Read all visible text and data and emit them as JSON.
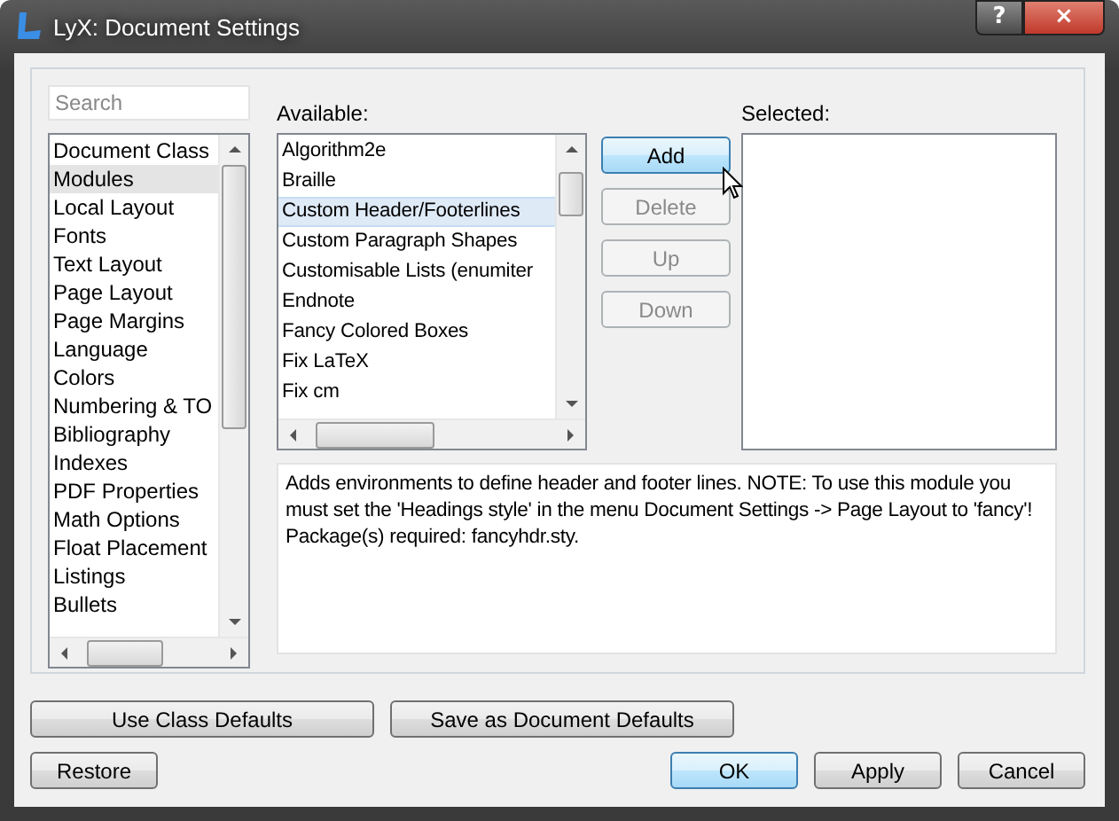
{
  "window": {
    "title": "LyX: Document Settings",
    "help_button": "?",
    "close_button": "×"
  },
  "search": {
    "placeholder": "Search"
  },
  "categories": [
    {
      "label": "Document Class",
      "selected": false
    },
    {
      "label": "Modules",
      "selected": true
    },
    {
      "label": "Local Layout",
      "selected": false
    },
    {
      "label": "Fonts",
      "selected": false
    },
    {
      "label": "Text Layout",
      "selected": false
    },
    {
      "label": "Page Layout",
      "selected": false
    },
    {
      "label": "Page Margins",
      "selected": false
    },
    {
      "label": "Language",
      "selected": false
    },
    {
      "label": "Colors",
      "selected": false
    },
    {
      "label": "Numbering & TO",
      "selected": false
    },
    {
      "label": "Bibliography",
      "selected": false
    },
    {
      "label": "Indexes",
      "selected": false
    },
    {
      "label": "PDF Properties",
      "selected": false
    },
    {
      "label": "Math Options",
      "selected": false
    },
    {
      "label": "Float Placement",
      "selected": false
    },
    {
      "label": "Listings",
      "selected": false
    },
    {
      "label": "Bullets",
      "selected": false
    }
  ],
  "available": {
    "label": "Available:",
    "items": [
      {
        "label": "Algorithm2e",
        "selected": false
      },
      {
        "label": "Braille",
        "selected": false
      },
      {
        "label": "Custom Header/Footerlines",
        "selected": true
      },
      {
        "label": "Custom Paragraph Shapes",
        "selected": false
      },
      {
        "label": "Customisable Lists (enumiter",
        "selected": false
      },
      {
        "label": "Endnote",
        "selected": false
      },
      {
        "label": "Fancy Colored Boxes",
        "selected": false
      },
      {
        "label": "Fix LaTeX",
        "selected": false
      },
      {
        "label": "Fix cm",
        "selected": false
      }
    ]
  },
  "module_buttons": [
    {
      "label": "Add",
      "disabled": false,
      "hovered": true
    },
    {
      "label": "Delete",
      "disabled": true,
      "hovered": false
    },
    {
      "label": "Up",
      "disabled": true,
      "hovered": false
    },
    {
      "label": "Down",
      "disabled": true,
      "hovered": false
    }
  ],
  "selected_modules": {
    "label": "Selected:"
  },
  "description": "Adds environments to define header and footer lines. NOTE: To use this module you must set the 'Headings style' in the menu Document Settings -> Page Layout to 'fancy'! Package(s) required: fancyhdr.sty.",
  "defaults_buttons": [
    "Use Class Defaults",
    "Save as Document Defaults"
  ],
  "restore_button": "Restore",
  "dialog_buttons": [
    {
      "label": "OK",
      "default": true
    },
    {
      "label": "Apply",
      "default": false
    },
    {
      "label": "Cancel",
      "default": false
    }
  ]
}
